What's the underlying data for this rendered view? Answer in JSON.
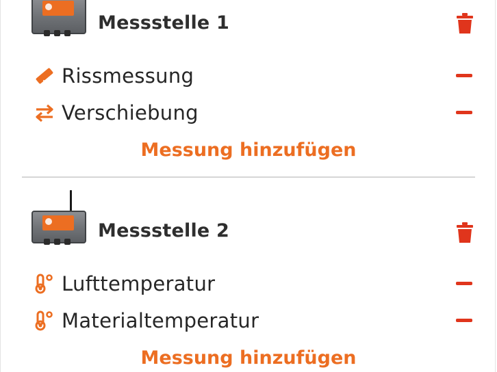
{
  "stations": [
    {
      "title": "Messstelle 1",
      "device_image": "rocket-ng-device",
      "delete_icon": "trash-icon",
      "measurements": [
        {
          "label": "Rissmessung",
          "icon": "ruler-icon"
        },
        {
          "label": "Verschiebung",
          "icon": "arrows-left-right-icon"
        }
      ],
      "add_label": "Messung hinzufügen"
    },
    {
      "title": "Messstelle 2",
      "device_image": "rocket-ng-device",
      "delete_icon": "trash-icon",
      "measurements": [
        {
          "label": "Lufttemperatur",
          "icon": "thermometer-icon"
        },
        {
          "label": "Materialtemperatur",
          "icon": "thermometer-icon"
        }
      ],
      "add_label": "Messung hinzufügen"
    }
  ],
  "colors": {
    "accent": "#ec6e22",
    "danger": "#e0351c",
    "text": "#2b2b2b",
    "divider": "#d5d5d5"
  }
}
